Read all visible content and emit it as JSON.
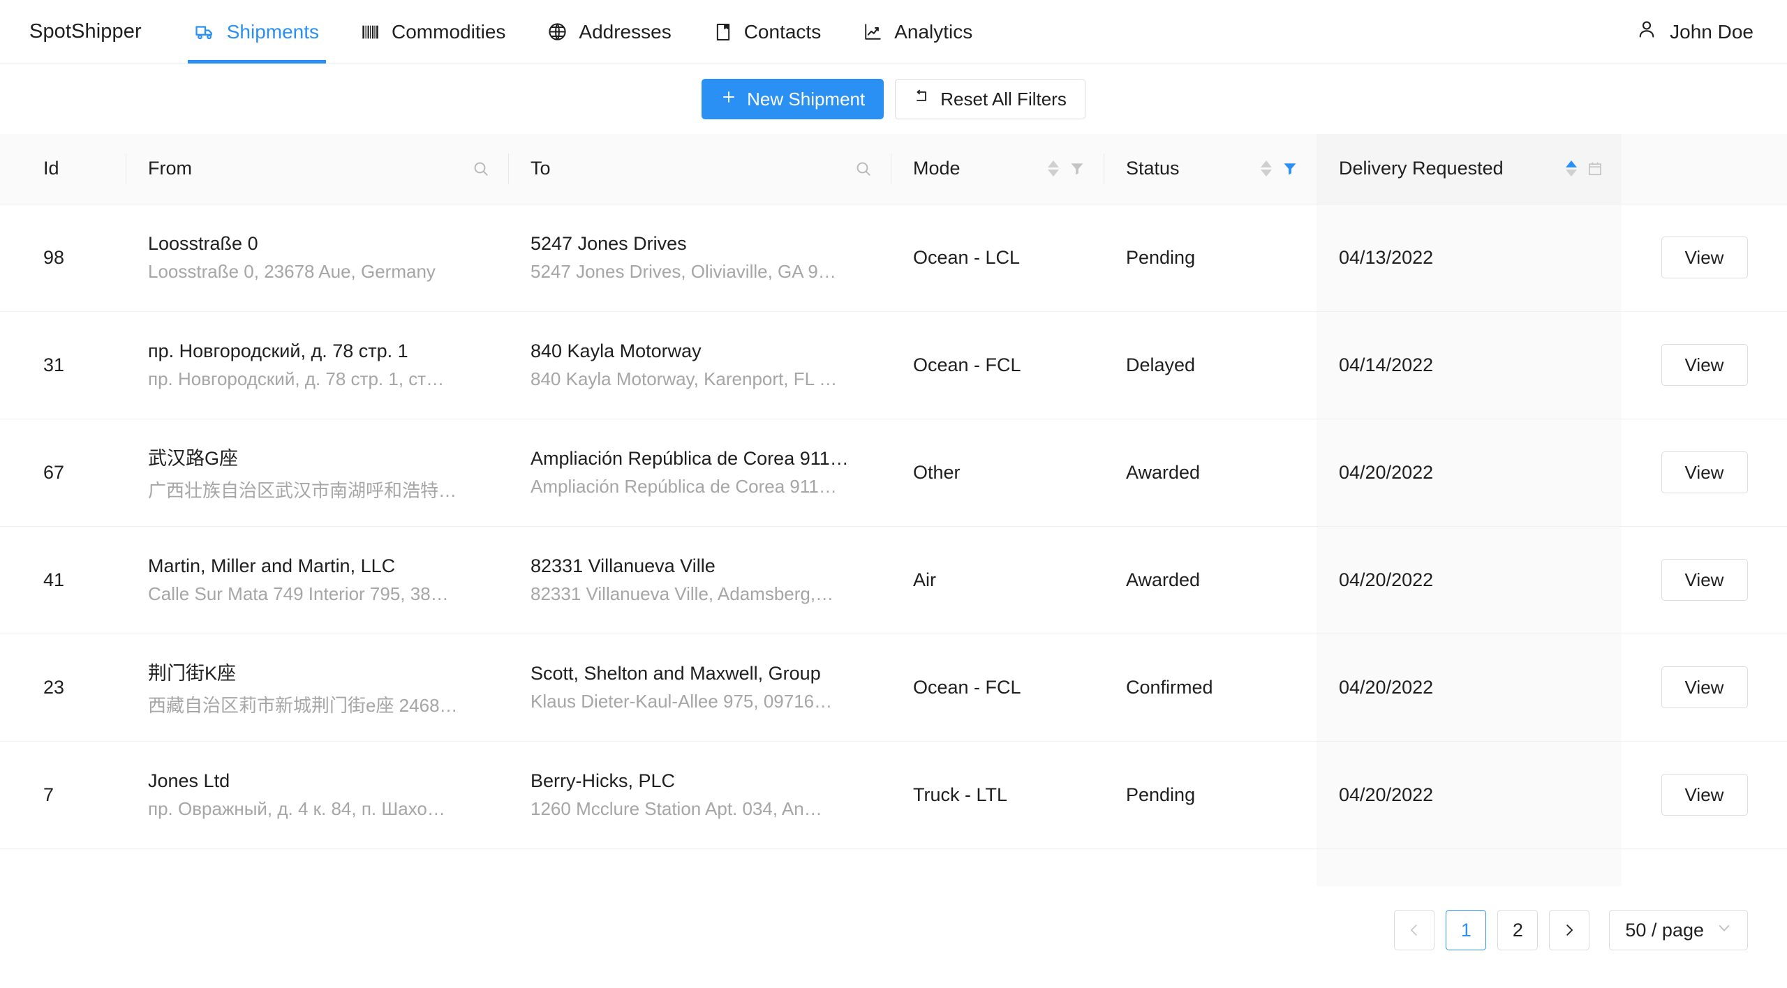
{
  "header": {
    "brand": "SpotShipper",
    "nav": [
      {
        "label": "Shipments",
        "icon": "truck-icon",
        "active": true
      },
      {
        "label": "Commodities",
        "icon": "barcode-icon",
        "active": false
      },
      {
        "label": "Addresses",
        "icon": "globe-icon",
        "active": false
      },
      {
        "label": "Contacts",
        "icon": "contact-icon",
        "active": false
      },
      {
        "label": "Analytics",
        "icon": "chart-icon",
        "active": false
      }
    ],
    "user": {
      "name": "John Doe",
      "icon": "user-icon"
    },
    "accent": "#2b90f4"
  },
  "toolbar": {
    "new_shipment_label": "New Shipment",
    "new_shipment_icon": "plus-icon",
    "reset_filters_label": "Reset All Filters",
    "reset_filters_icon": "reset-icon"
  },
  "table": {
    "columns": [
      {
        "key": "id",
        "label": "Id",
        "tools": []
      },
      {
        "key": "from",
        "label": "From",
        "tools": [
          "search-icon"
        ]
      },
      {
        "key": "to",
        "label": "To",
        "tools": [
          "search-icon"
        ]
      },
      {
        "key": "mode",
        "label": "Mode",
        "tools": [
          "sorter",
          "filter-icon"
        ]
      },
      {
        "key": "status",
        "label": "Status",
        "tools": [
          "sorter",
          "filter-icon-active"
        ]
      },
      {
        "key": "date",
        "label": "Delivery Requested",
        "tools": [
          "sorter-asc",
          "calendar-icon"
        ]
      },
      {
        "key": "action",
        "label": "",
        "tools": []
      }
    ],
    "sorted_column": "Delivery Requested",
    "sort_direction": "ascending",
    "active_filter_column": "Status",
    "action_label": "View",
    "rows": [
      {
        "id": "98",
        "from_main": "Loosstraße 0",
        "from_sub": "Loosstraße 0, 23678 Aue, Germany",
        "to_main": "5247 Jones Drives",
        "to_sub": "5247 Jones Drives, Oliviaville, GA 9…",
        "mode": "Ocean - LCL",
        "status": "Pending",
        "date": "04/13/2022"
      },
      {
        "id": "31",
        "from_main": "пр. Новгородский, д. 78 стр. 1",
        "from_sub": "пр. Новгородский, д. 78 стр. 1, ст…",
        "to_main": "840 Kayla Motorway",
        "to_sub": "840 Kayla Motorway, Karenport, FL …",
        "mode": "Ocean - FCL",
        "status": "Delayed",
        "date": "04/14/2022"
      },
      {
        "id": "67",
        "from_main": "武汉路G座",
        "from_sub": "广西壮族自治区武汉市南湖呼和浩特…",
        "to_main": "Ampliación República de Corea 911…",
        "to_sub": "Ampliación República de Corea 911…",
        "mode": "Other",
        "status": "Awarded",
        "date": "04/20/2022"
      },
      {
        "id": "41",
        "from_main": "Martin, Miller and Martin, LLC",
        "from_sub": "Calle Sur Mata 749 Interior 795, 38…",
        "to_main": "82331 Villanueva Ville",
        "to_sub": "82331 Villanueva Ville, Adamsberg,…",
        "mode": "Air",
        "status": "Awarded",
        "date": "04/20/2022"
      },
      {
        "id": "23",
        "from_main": "荆门街K座",
        "from_sub": "西藏自治区莉市新城荆门街e座 2468…",
        "to_main": "Scott, Shelton and Maxwell, Group",
        "to_sub": "Klaus Dieter-Kaul-Allee 975, 09716…",
        "mode": "Ocean - FCL",
        "status": "Confirmed",
        "date": "04/20/2022"
      },
      {
        "id": "7",
        "from_main": "Jones Ltd",
        "from_sub": "пр. Овражный, д. 4 к. 84, п. Шахо…",
        "to_main": "Berry-Hicks, PLC",
        "to_sub": "1260 Mcclure Station Apt. 034, An…",
        "mode": "Truck - LTL",
        "status": "Pending",
        "date": "04/20/2022"
      }
    ]
  },
  "pagination": {
    "prev_label": "‹",
    "next_label": "›",
    "pages": [
      "1",
      "2"
    ],
    "current_page": "1",
    "page_size_label": "50 / page"
  }
}
